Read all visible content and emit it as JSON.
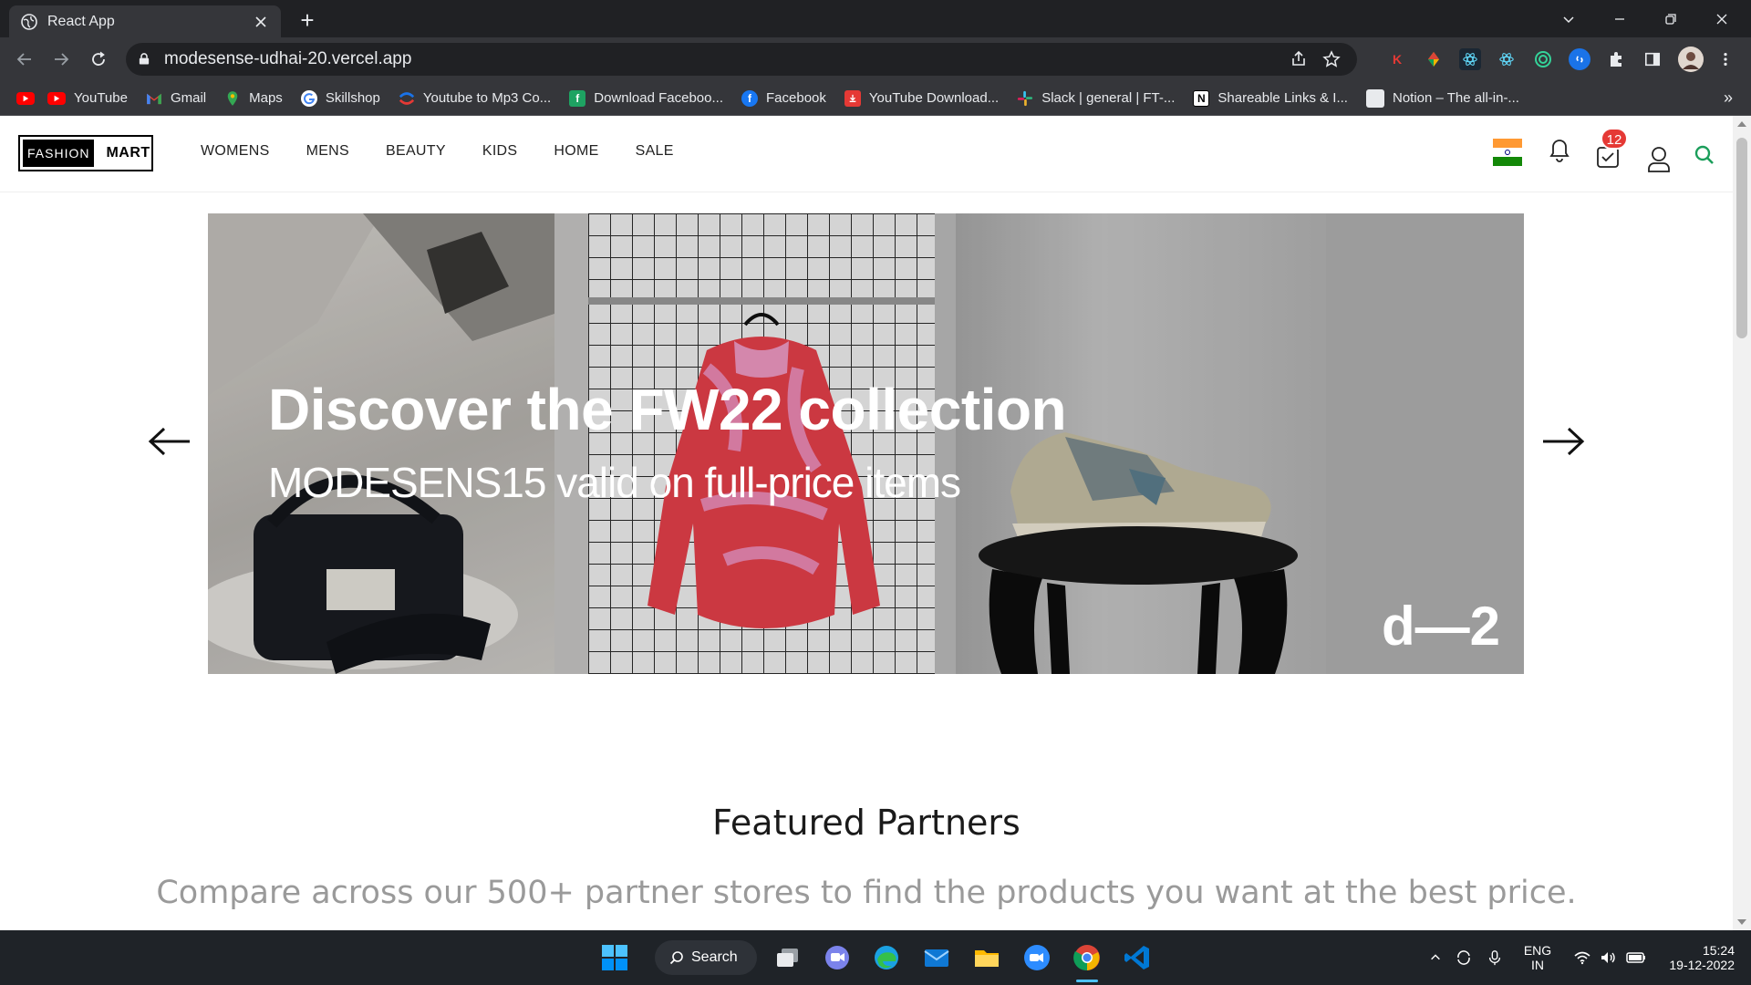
{
  "browser": {
    "tab_title": "React App",
    "new_tab": "+",
    "url": "modesense-udhai-20.vercel.app",
    "bookmarks_more": "»",
    "bookmarks": [
      {
        "label": "",
        "icon": "youtube-icon",
        "color": "#ff0000"
      },
      {
        "label": "YouTube",
        "icon": "youtube-icon",
        "color": "#ff0000"
      },
      {
        "label": "Gmail",
        "icon": "gmail-icon",
        "color": "#ea4335"
      },
      {
        "label": "Maps",
        "icon": "maps-icon",
        "color": "#34a853"
      },
      {
        "label": "Skillshop",
        "icon": "google-icon",
        "color": "#4285f4"
      },
      {
        "label": "Youtube to Mp3 Co...",
        "icon": "converter-icon",
        "color": "#e53935"
      },
      {
        "label": "Download Faceboo...",
        "icon": "facebook-download-icon",
        "color": "#1ea362"
      },
      {
        "label": "Facebook",
        "icon": "facebook-icon",
        "color": "#1877f2"
      },
      {
        "label": "YouTube Download...",
        "icon": "download-icon",
        "color": "#e53935"
      },
      {
        "label": "Slack | general | FT-...",
        "icon": "slack-icon",
        "color": "#e01e5a"
      },
      {
        "label": "Shareable Links & I...",
        "icon": "notion-icon",
        "color": "#000000"
      },
      {
        "label": "Notion – The all-in-...",
        "icon": "notion-page-icon",
        "color": "#e8eaed"
      }
    ]
  },
  "site": {
    "logo_part1": "FASHION",
    "logo_part2": "MART",
    "nav": [
      "WOMENS",
      "MENS",
      "BEAUTY",
      "KIDS",
      "HOME",
      "SALE"
    ],
    "cart_count": "12",
    "colors": {
      "accent": "#1b9e5b",
      "badge": "#e53935"
    }
  },
  "hero": {
    "title": "Discover the FW22 collection",
    "subtitle": "MODESENS15 valid on full-price items",
    "mark": "d—2"
  },
  "featured": {
    "title": "Featured Partners",
    "subtitle": "Compare across our 500+ partner stores to find the products you want at the best price."
  },
  "taskbar": {
    "search_label": "Search",
    "lang": "ENG",
    "region": "IN",
    "time": "15:24",
    "date": "19-12-2022"
  }
}
